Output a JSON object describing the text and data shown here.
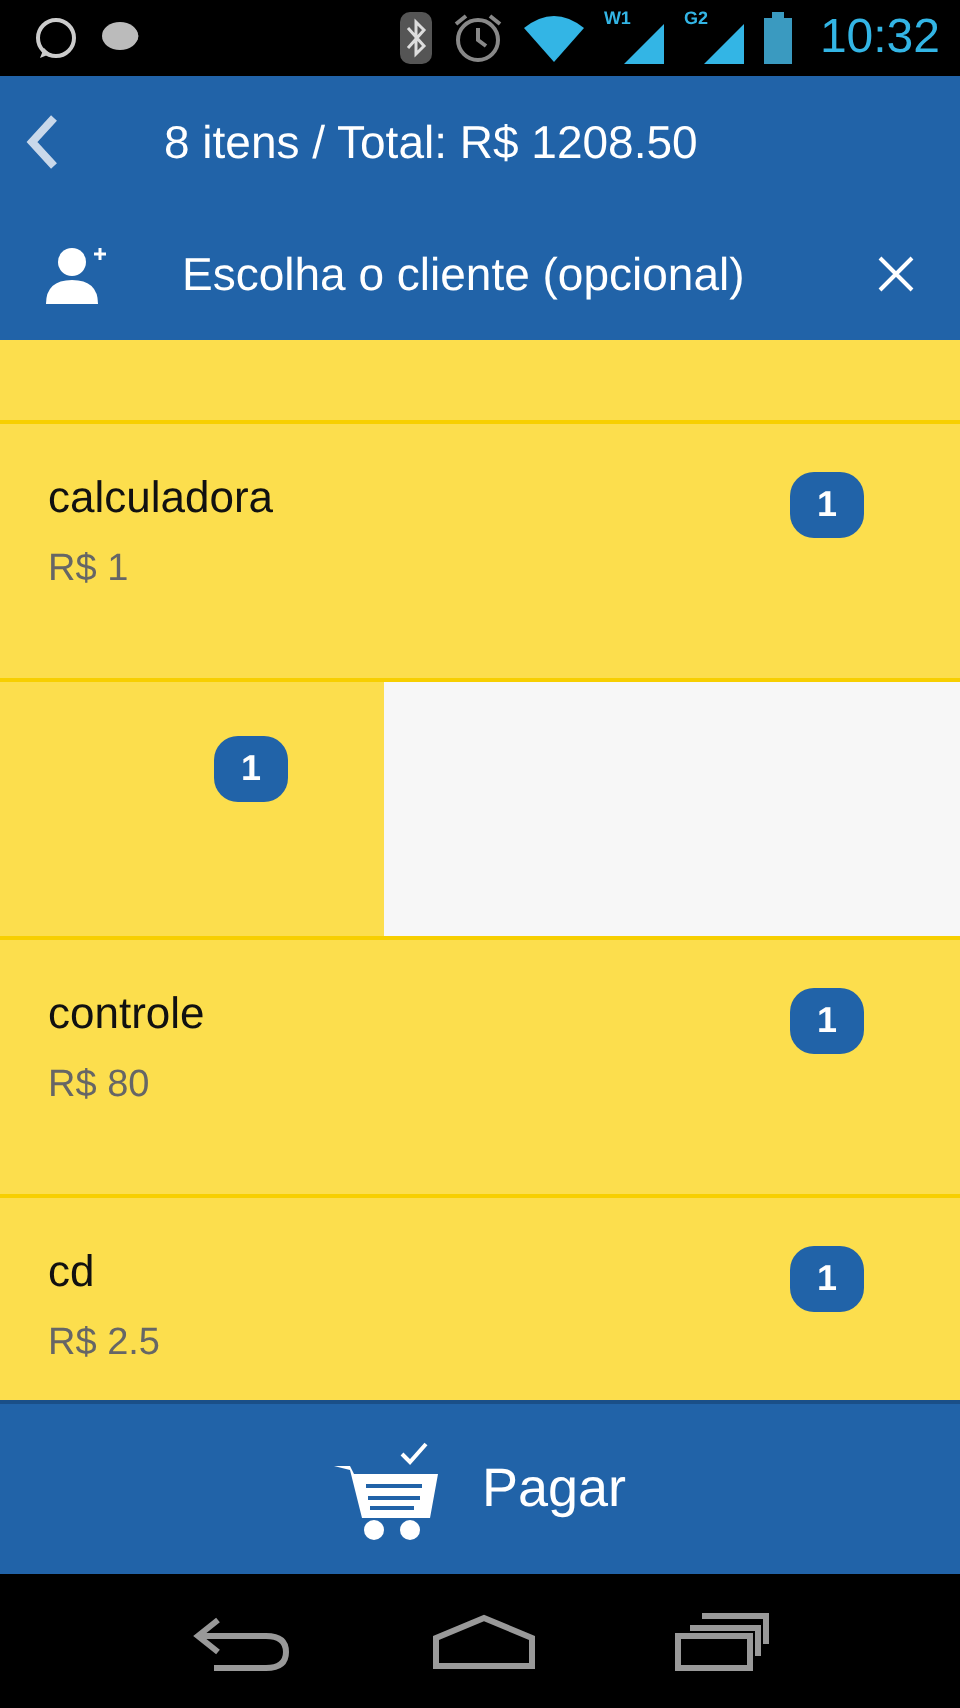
{
  "status_bar": {
    "signal_labels": [
      "W1",
      "G2"
    ],
    "time": "10:32"
  },
  "header": {
    "title": "8 itens / Total: R$ 1208.50"
  },
  "client_bar": {
    "label": "Escolha o cliente (opcional)"
  },
  "items": [
    {
      "kind": "normal",
      "name": "calculadora",
      "price": "R$ 1",
      "quantity": "1"
    },
    {
      "kind": "swiped",
      "quantity": "1"
    },
    {
      "kind": "normal",
      "name": "controle",
      "price": "R$ 80",
      "quantity": "1"
    },
    {
      "kind": "normal",
      "name": "cd",
      "price": "R$ 2.5",
      "quantity": "1"
    }
  ],
  "pay_button": {
    "label": "Pagar"
  }
}
